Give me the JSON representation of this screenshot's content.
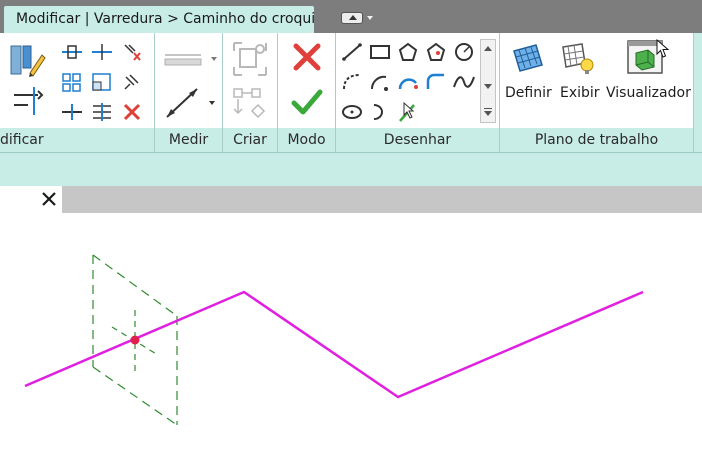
{
  "title_tab": {
    "label": "Modificar | Varredura > Caminho do croqui"
  },
  "ribbon": {
    "panels": {
      "modificar": {
        "label": "dificar"
      },
      "medir": {
        "label": "Medir"
      },
      "criar": {
        "label": "Criar"
      },
      "modo": {
        "label": "Modo"
      },
      "desenhar": {
        "label": "Desenhar"
      },
      "plano": {
        "label": "Plano de trabalho"
      }
    },
    "buttons": {
      "definir": "Definir",
      "exibir": "Exibir",
      "visualizador": "Visualizador"
    }
  },
  "colors": {
    "ribbon_bg": "#c8ece6",
    "sketch_path": "#e020e0",
    "profile_plane": "#2e8b2e",
    "cancel_red": "#e0403a",
    "finish_green": "#3aa83a",
    "accent_blue": "#1f7fd1"
  },
  "icons": {
    "view_tab_close": "close-icon",
    "finish": "checkmark-icon",
    "cancel": "x-cancel-icon"
  }
}
